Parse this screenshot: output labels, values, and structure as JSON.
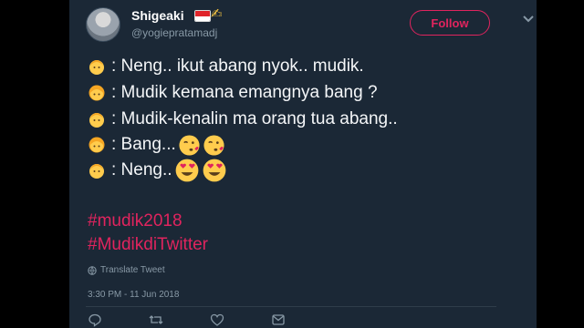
{
  "tweet": {
    "user_name": "Shigeaki",
    "handle": "@yogiepratamadj",
    "follow_label": "Follow",
    "lines": [
      {
        "speaker": "man",
        "text": ": Neng.. ikut abang nyok.. mudik."
      },
      {
        "speaker": "woman",
        "text": ": Mudik kemana emangnya bang ?"
      },
      {
        "speaker": "man",
        "text": ": Mudik-kenalin ma orang tua abang.."
      },
      {
        "speaker": "woman",
        "text": ": Bang...",
        "emojis": [
          "face-blowing-kiss-icon",
          "face-blowing-kiss-icon"
        ]
      },
      {
        "speaker": "man",
        "text": ": Neng..",
        "emojis": [
          "heart-eyes-face-icon",
          "heart-eyes-face-icon"
        ]
      }
    ],
    "hashtags": [
      "#mudik2018",
      "#MudikdiTwitter"
    ],
    "translate_label": "Translate Tweet",
    "timestamp": "3:30 PM - 11 Jun 2018"
  },
  "colors": {
    "background": "#1b2836",
    "accent": "#e0245e",
    "muted": "#8899a6"
  },
  "icons": [
    "indonesia-flag-icon",
    "raised-hand-icon",
    "chevron-down-icon",
    "globe-icon",
    "reply-icon",
    "retweet-icon",
    "like-icon",
    "message-icon"
  ]
}
